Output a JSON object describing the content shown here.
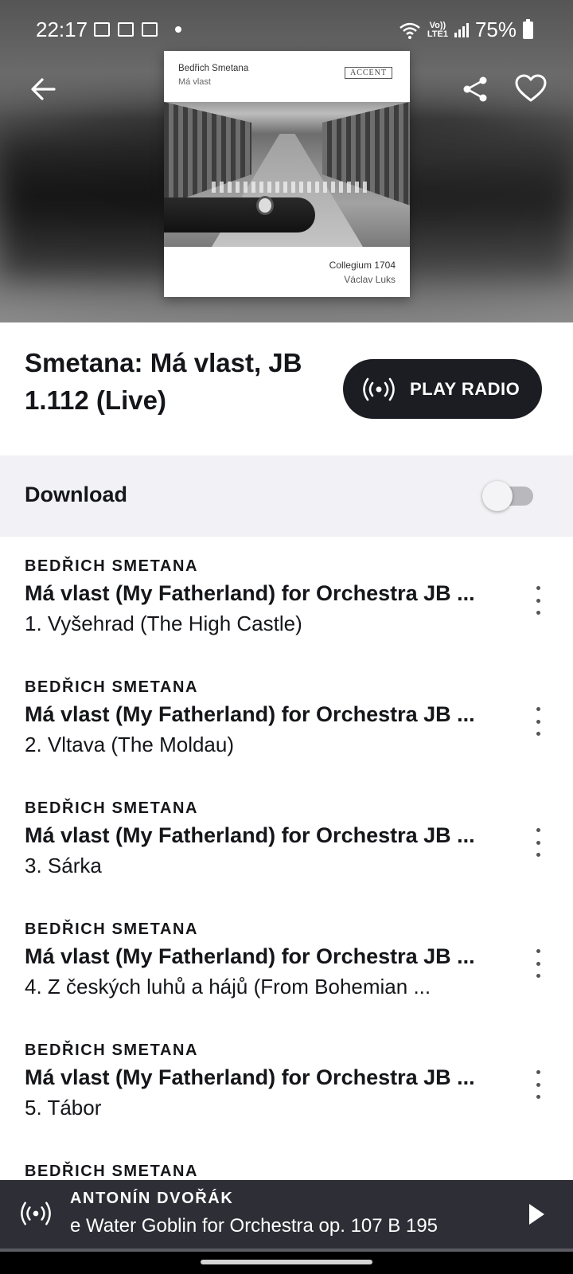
{
  "status_bar": {
    "time": "22:17",
    "network_top": "Vo))",
    "network_bottom": "LTE1",
    "battery": "75%"
  },
  "header": {
    "back_icon": "arrow-left-icon",
    "share_icon": "share-icon",
    "favorite_icon": "heart-outline-icon"
  },
  "cover": {
    "composer": "Bedřich Smetana",
    "work": "Má vlast",
    "label": "ACCENT",
    "ensemble": "Collegium 1704",
    "conductor": "Václav Luks"
  },
  "album": {
    "title": "Smetana: Má vlast, JB 1.112 (Live)"
  },
  "play_radio": {
    "label": "PLAY RADIO",
    "icon": "radio-broadcast-icon"
  },
  "download": {
    "label": "Download",
    "enabled": false
  },
  "tracks": [
    {
      "composer": "BEDŘICH SMETANA",
      "work": "Má vlast (My Fatherland) for Orchestra JB ...",
      "name": "1. Vyšehrad (The High Castle)"
    },
    {
      "composer": "BEDŘICH SMETANA",
      "work": "Má vlast (My Fatherland) for Orchestra JB ...",
      "name": "2. Vltava (The Moldau)"
    },
    {
      "composer": "BEDŘICH SMETANA",
      "work": "Má vlast (My Fatherland) for Orchestra JB ...",
      "name": "3. Sárka"
    },
    {
      "composer": "BEDŘICH SMETANA",
      "work": "Má vlast (My Fatherland) for Orchestra JB ...",
      "name": "4. Z českých luhů a hájů (From Bohemian ..."
    },
    {
      "composer": "BEDŘICH SMETANA",
      "work": "Má vlast (My Fatherland) for Orchestra JB ...",
      "name": "5. Tábor"
    },
    {
      "composer": "BEDŘICH SMETANA",
      "work": "",
      "name": ""
    }
  ],
  "mini_player": {
    "composer": "ANTONÍN DVOŘÁK",
    "title": "e Water Goblin for Orchestra op. 107 B 195",
    "icon": "radio-broadcast-icon",
    "play_icon": "play-icon"
  },
  "colors": {
    "primary_dark": "#1c1d22",
    "download_bg": "#f1f1f6",
    "mini_player_bg": "#2e2f36"
  }
}
